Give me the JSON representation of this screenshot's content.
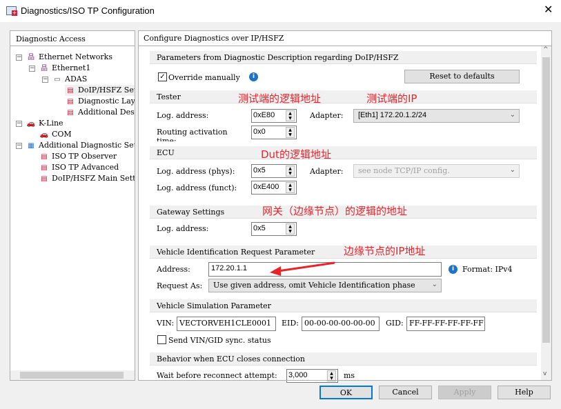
{
  "window": {
    "title": "Diagnostics/ISO TP Configuration",
    "close_icon": "close-icon"
  },
  "left": {
    "header": "Diagnostic Access",
    "tree": [
      {
        "label": "Ethernet Networks",
        "icon": "network-icon"
      },
      {
        "label": "Ethernet1",
        "icon": "network-icon"
      },
      {
        "label": "ADAS",
        "icon": "computer-icon"
      },
      {
        "label": "DoIP/HSFZ Settings",
        "icon": "diag-doc-icon"
      },
      {
        "label": "Diagnostic Layer",
        "icon": "diag-doc-icon"
      },
      {
        "label": "Additional Descriptions",
        "icon": "diag-doc-icon"
      },
      {
        "label": "K-Line",
        "icon": "car-icon"
      },
      {
        "label": "COM",
        "icon": "car-icon"
      },
      {
        "label": "Additional Diagnostic Settings",
        "icon": "diag-folder-icon"
      },
      {
        "label": "ISO TP Observer",
        "icon": "diag-doc-icon"
      },
      {
        "label": "ISO TP Advanced",
        "icon": "diag-doc-icon"
      },
      {
        "label": "DoIP/HSFZ Main Settings",
        "icon": "diag-doc-icon"
      }
    ]
  },
  "right": {
    "header": "Configure Diagnostics over IP/HSFZ",
    "params": {
      "title": "Parameters from Diagnostic Description regarding DoIP/HSFZ",
      "override_label": "Override manually",
      "override_checked": true,
      "reset_label": "Reset to defaults"
    },
    "tester": {
      "title": "Tester",
      "log_label": "Log. address:",
      "log_value": "0xE80",
      "adapter_label": "Adapter:",
      "adapter_value": "[Eth1]  172.20.1.2/24",
      "routing_label": "Routing activation time:",
      "routing_value": "0x0"
    },
    "ecu": {
      "title": "ECU",
      "phys_label": "Log. address (phys):",
      "phys_value": "0x5",
      "adapter_label": "Adapter:",
      "adapter_value": "see node TCP/IP config.",
      "funct_label": "Log. address (funct):",
      "funct_value": "0xE400"
    },
    "gateway": {
      "title": "Gateway Settings",
      "log_label": "Log. address:",
      "log_value": "0x5"
    },
    "vehicle_id": {
      "title": "Vehicle Identification Request Parameter",
      "address_label": "Address:",
      "address_value": "172.20.1.1",
      "format": "Format: IPv4",
      "request_label": "Request As:",
      "request_value": "Use given address, omit Vehicle Identification phase"
    },
    "vehicle_sim": {
      "title": "Vehicle Simulation Parameter",
      "vin_label": "VIN:",
      "vin_value": "VECTORVEH1CLE0001",
      "eid_label": "EID:",
      "eid_value": "00-00-00-00-00-00",
      "gid_label": "GID:",
      "gid_value": "FF-FF-FF-FF-FF-FF",
      "send_label": "Send VIN/GID sync. status",
      "send_checked": false
    },
    "behavior": {
      "title": "Behavior when ECU closes connection",
      "wait_label": "Wait before reconnect attempt:",
      "wait_value": "3,000",
      "wait_unit": "ms"
    }
  },
  "annotations": {
    "tester_logical": "测试端的逻辑地址",
    "tester_ip": "测试端的IP",
    "dut_logical": "Dut的逻辑地址",
    "gateway_logical": "网关（边缘节点）的逻辑的地址",
    "edge_ip": "边缘节点的IP地址",
    "arrow_color": "#e8242b"
  },
  "buttons": {
    "ok": "OK",
    "cancel": "Cancel",
    "apply": "Apply",
    "help": "Help"
  }
}
